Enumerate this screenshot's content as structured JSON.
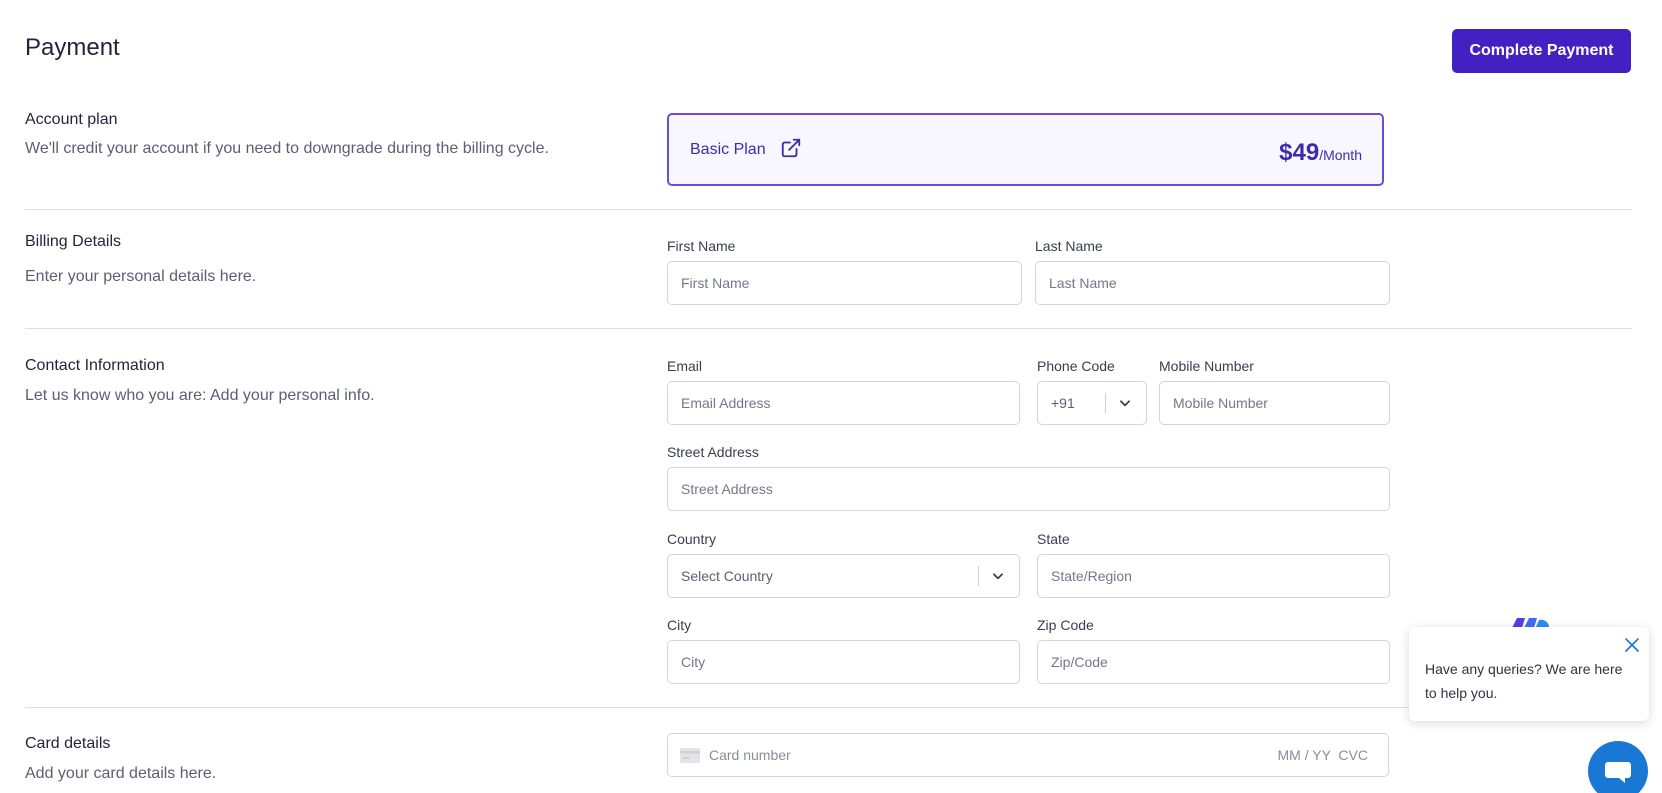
{
  "page": {
    "title": "Payment",
    "complete_button": "Complete Payment"
  },
  "account_plan": {
    "title": "Account plan",
    "description": "We'll credit your account if you need to downgrade during the billing cycle.",
    "plan_name": "Basic Plan",
    "price": "$49",
    "period": "/Month"
  },
  "billing": {
    "title": "Billing Details",
    "description": "Enter your personal details here.",
    "first_name_label": "First Name",
    "first_name_placeholder": "First Name",
    "last_name_label": "Last Name",
    "last_name_placeholder": "Last Name"
  },
  "contact": {
    "title": "Contact Information",
    "description": "Let us know who you are: Add your personal info.",
    "email_label": "Email",
    "email_placeholder": "Email Address",
    "phone_code_label": "Phone Code",
    "phone_code_value": "+91",
    "mobile_label": "Mobile Number",
    "mobile_placeholder": "Mobile Number",
    "street_label": "Street Address",
    "street_placeholder": "Street Address",
    "country_label": "Country",
    "country_value": "Select Country",
    "state_label": "State",
    "state_placeholder": "State/Region",
    "city_label": "City",
    "city_placeholder": "City",
    "zip_label": "Zip Code",
    "zip_placeholder": "Zip/Code"
  },
  "card": {
    "title": "Card details",
    "description": "Add your card details here.",
    "number_placeholder": "Card number",
    "expiry_cvc_placeholder": "MM / YY  CVC"
  },
  "chat": {
    "message": "Have any queries? We are here to help you."
  },
  "colors": {
    "primary": "#4320c2",
    "accent_text": "#3b2bb0",
    "plan_border": "#6a4ed6",
    "chat_blue": "#1978d4"
  },
  "icons": {
    "plan_link": "external-link-icon",
    "select_arrow": "chevron-down-icon",
    "card": "credit-card-icon",
    "chat_close": "close-icon",
    "chat": "chat-bubble-icon"
  }
}
